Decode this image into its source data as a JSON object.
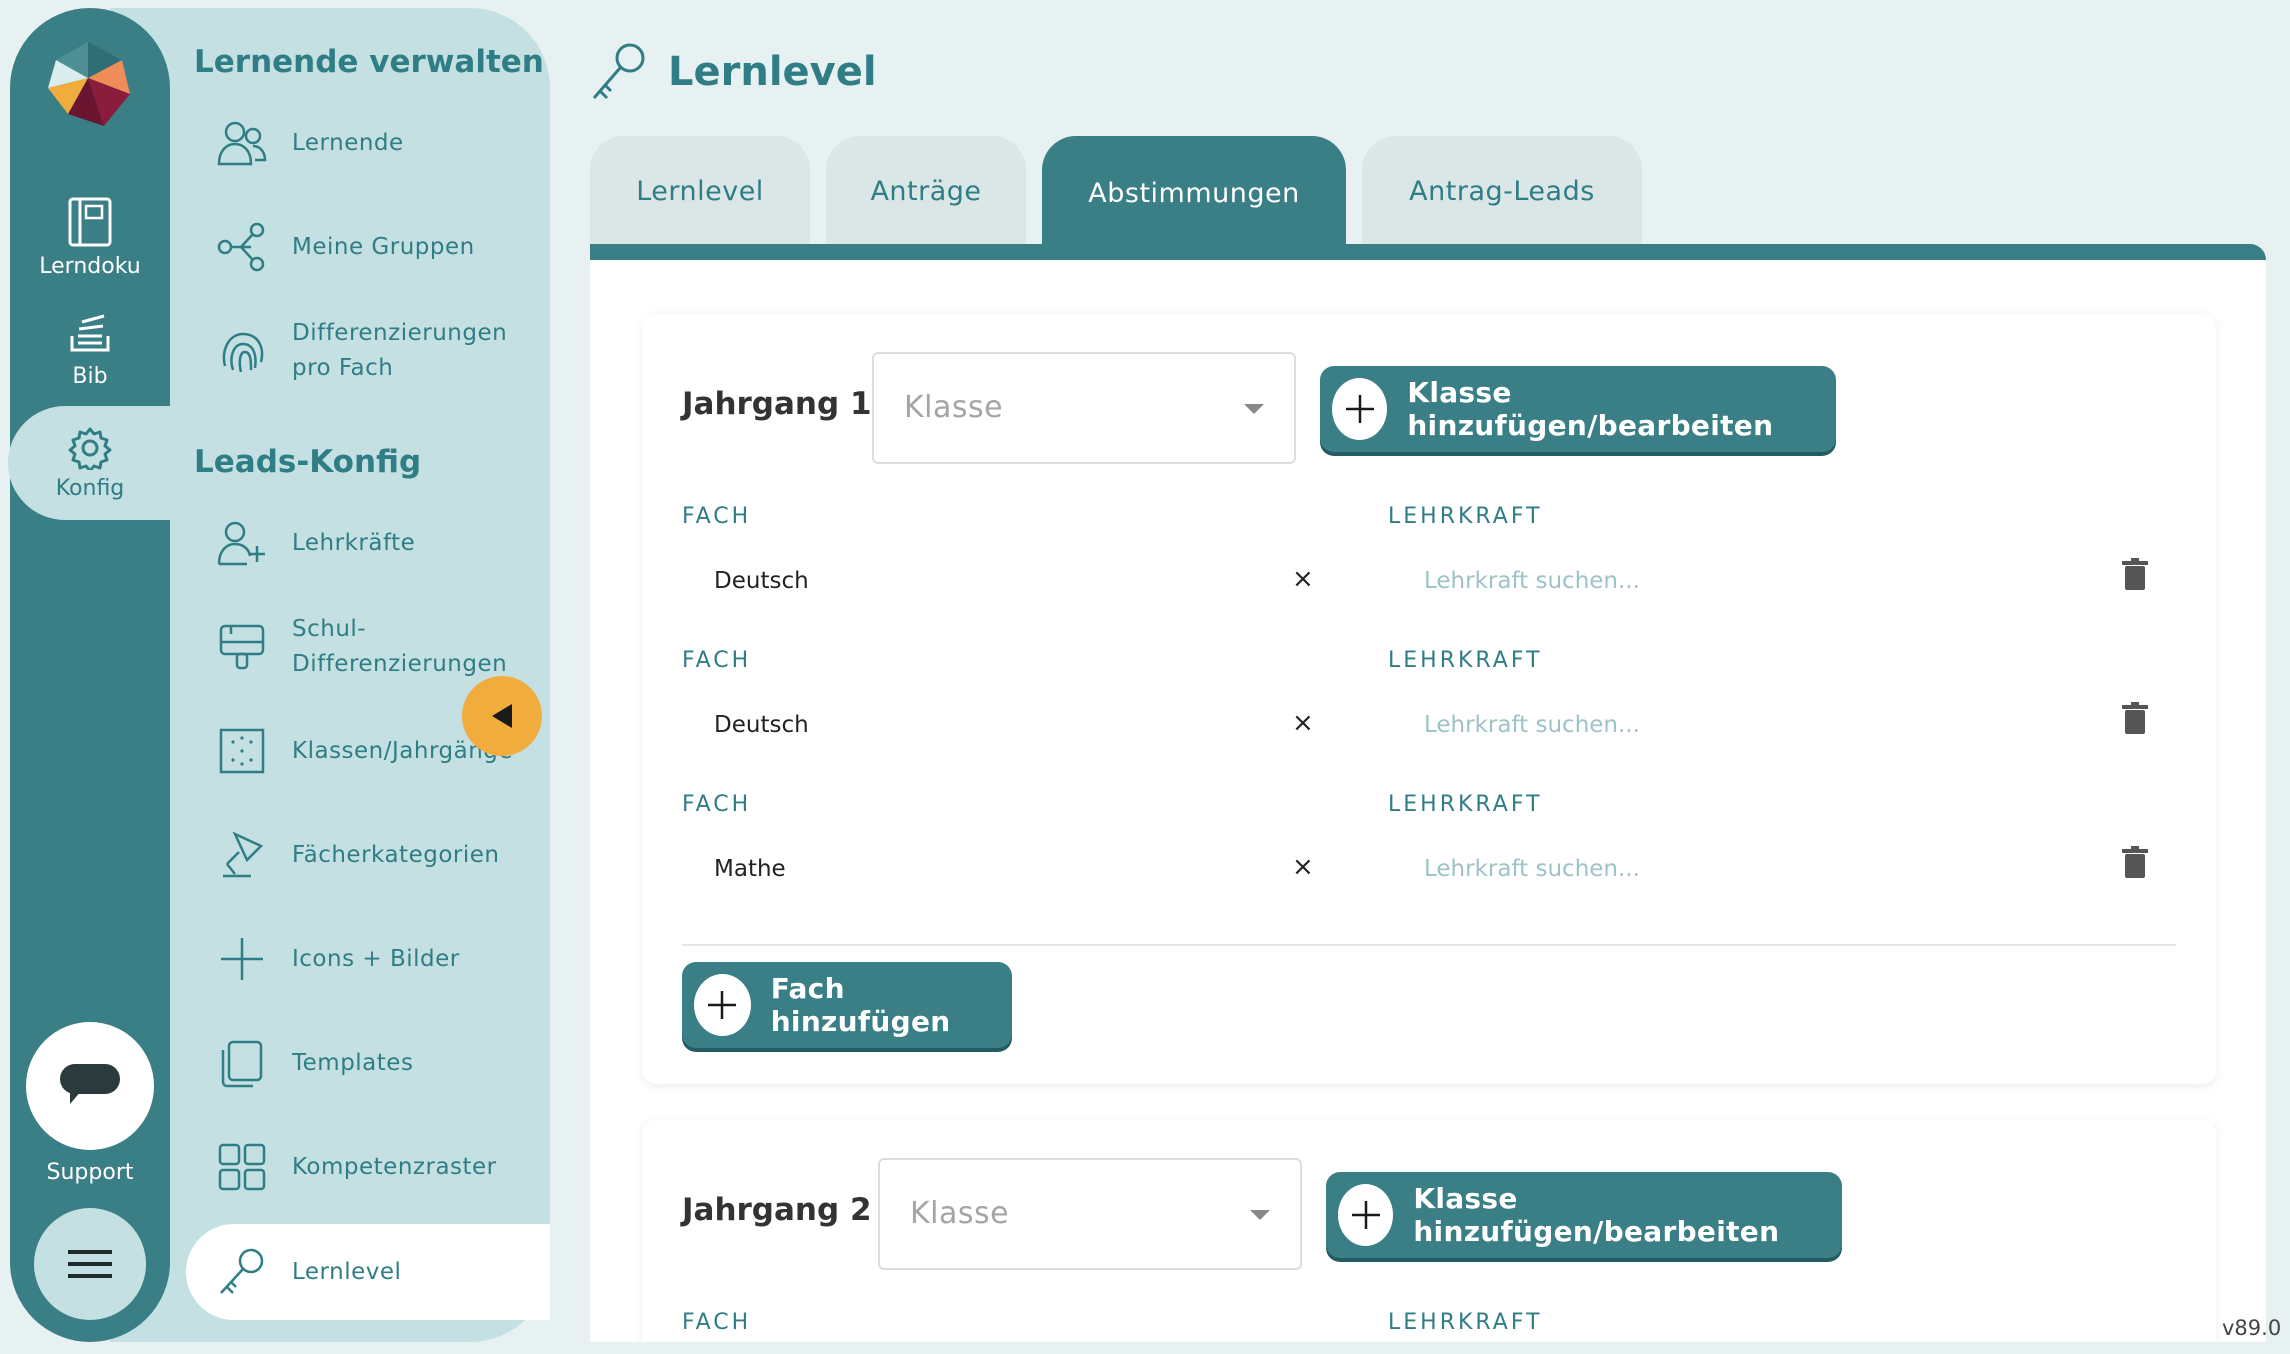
{
  "rail": {
    "items": [
      {
        "label": "Lerndoku",
        "icon": "notebook-icon"
      },
      {
        "label": "Bib",
        "icon": "library-icon"
      },
      {
        "label": "Konfig",
        "icon": "gear-icon"
      }
    ],
    "support_label": "Support"
  },
  "sidebar": {
    "section1_title": "Lernende verwalten",
    "section1_items": [
      {
        "label": "Lernende",
        "icon": "users-icon"
      },
      {
        "label": "Meine Gruppen",
        "icon": "share-nodes-icon"
      },
      {
        "label": "Differenzierungen\npro Fach",
        "icon": "fingerprint-icon"
      }
    ],
    "section2_title": "Leads-Konfig",
    "section2_items": [
      {
        "label": "Lehrkräfte",
        "icon": "user-plus-icon"
      },
      {
        "label": "Schul-\nDifferenzierungen",
        "icon": "paint-roller-icon"
      },
      {
        "label": "Klassen/Jahrgänge",
        "icon": "grid-dots-icon"
      },
      {
        "label": "Fächerkategorien",
        "icon": "desk-lamp-icon"
      },
      {
        "label": "Icons + Bilder",
        "icon": "plus-icon"
      },
      {
        "label": "Templates",
        "icon": "copy-icon"
      },
      {
        "label": "Kompetenzraster",
        "icon": "grid-icon"
      },
      {
        "label": "Lernlevel",
        "icon": "key-icon",
        "active": true
      }
    ]
  },
  "page": {
    "title": "Lernlevel",
    "tabs": [
      {
        "label": "Lernlevel"
      },
      {
        "label": "Anträge"
      },
      {
        "label": "Abstimmungen",
        "active": true
      },
      {
        "label": "Antrag-Leads"
      }
    ]
  },
  "jahrgang1": {
    "label": "Jahrgang 1",
    "klasse_placeholder": "Klasse",
    "add_class_label": "Klasse hinzufügen/bearbeiten",
    "fach_label": "FACH",
    "lehrkraft_label": "LEHRKRAFT",
    "rows": [
      {
        "fach": "Deutsch",
        "clear": "×",
        "lehrkraft_placeholder": "Lehrkraft suchen..."
      },
      {
        "fach": "Deutsch",
        "clear": "×",
        "lehrkraft_placeholder": "Lehrkraft suchen..."
      },
      {
        "fach": "Mathe",
        "clear": "×",
        "lehrkraft_placeholder": "Lehrkraft suchen..."
      }
    ],
    "add_subject_label": "Fach hinzufügen"
  },
  "jahrgang2": {
    "label": "Jahrgang 2",
    "klasse_placeholder": "Klasse",
    "add_class_label": "Klasse hinzufügen/bearbeiten",
    "fach_label": "FACH",
    "lehrkraft_label": "LEHRKRAFT"
  },
  "version": "v89.0",
  "colors": {
    "primary": "#3a7e86",
    "sidebar": "#c5e0e2",
    "background": "#e8f1f2",
    "accent": "#f0ad3e"
  }
}
